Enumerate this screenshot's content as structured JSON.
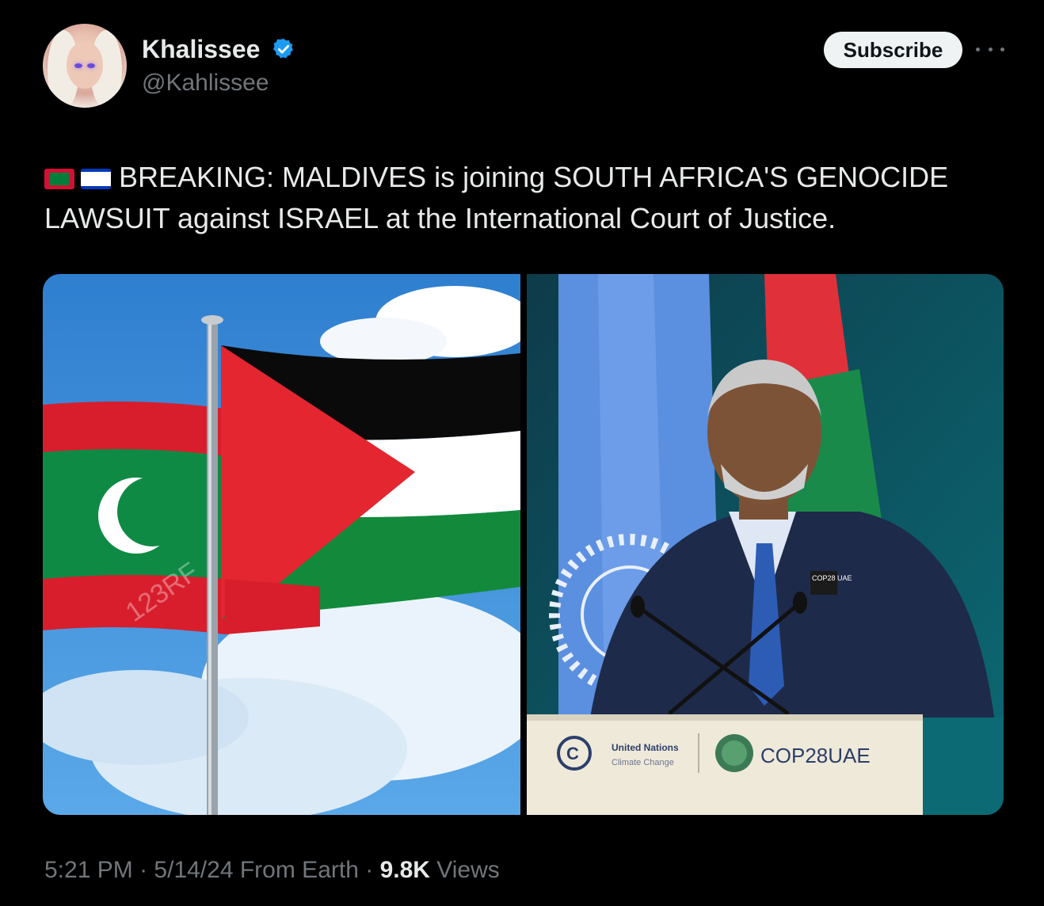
{
  "user": {
    "display_name": "Khalissee",
    "handle": "@Kahlissee",
    "verified_icon": "verified-badge-icon",
    "avatar_icon": "profile-avatar"
  },
  "actions": {
    "subscribe_label": "Subscribe",
    "more_icon": "more-options-icon"
  },
  "tweet": {
    "flags": [
      "maldives-flag-icon",
      "israel-flag-icon"
    ],
    "text": "BREAKING: MALDIVES is joining SOUTH AFRICA'S GENOCIDE LAWSUIT against ISRAEL at the International Court of Justice."
  },
  "media": {
    "left_image": {
      "watermark": "123RF"
    },
    "right_image": {
      "podium_logo_left_line1": "United Nations",
      "podium_logo_left_line2": "Climate Change",
      "podium_logo_right": "COP28UAE",
      "lapel_badge": "COP28 UAE"
    }
  },
  "meta": {
    "time": "5:21 PM",
    "separator": "·",
    "date": "5/14/24",
    "source": "From Earth",
    "views_count": "9.8K",
    "views_label": "Views"
  },
  "colors": {
    "background": "#000000",
    "text_primary": "#e7e9ea",
    "text_secondary": "#71767b",
    "verified_blue": "#1d9bf0"
  }
}
